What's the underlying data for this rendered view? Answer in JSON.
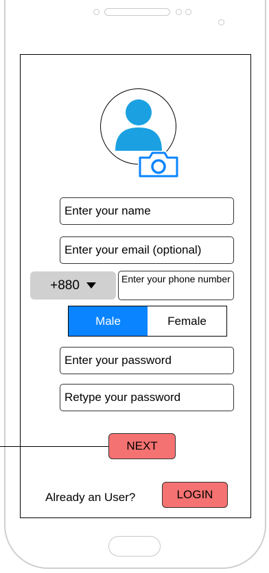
{
  "form": {
    "name_placeholder": "Enter your name",
    "email_placeholder": "Enter your email (optional)",
    "country_code": "+880",
    "phone_placeholder": "Enter your phone number",
    "gender_options": [
      {
        "label": "Male",
        "selected": true
      },
      {
        "label": "Female",
        "selected": false
      }
    ],
    "password_placeholder": "Enter your password",
    "retype_password_placeholder": "Retype your password",
    "next_label": "NEXT"
  },
  "footer": {
    "login_prompt": "Already an User?",
    "login_label": "LOGIN"
  },
  "colors": {
    "accent": "#0a84ff",
    "action_button": "#f47271",
    "country_code_bg": "#d0d0d0"
  },
  "icons": {
    "avatar": "user-avatar-icon",
    "camera": "camera-icon",
    "dropdown": "caret-down-icon"
  }
}
